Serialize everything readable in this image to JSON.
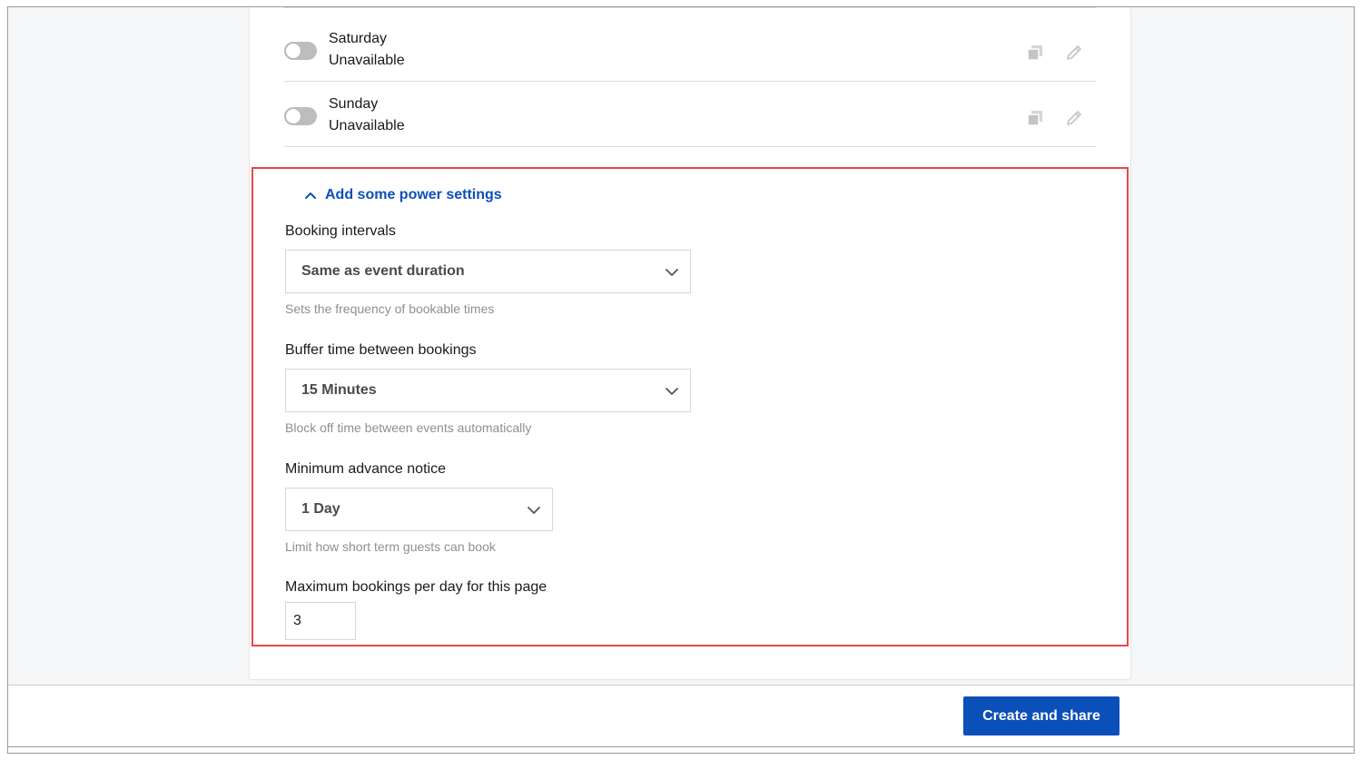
{
  "schedule": {
    "days": [
      {
        "name": "Saturday",
        "status": "Unavailable",
        "enabled": false
      },
      {
        "name": "Sunday",
        "status": "Unavailable",
        "enabled": false
      }
    ]
  },
  "power_settings": {
    "toggle_label": "Add some power settings",
    "expanded": true,
    "booking_intervals": {
      "label": "Booking intervals",
      "value": "Same as event duration",
      "help": "Sets the frequency of bookable times"
    },
    "buffer_time": {
      "label": "Buffer time between bookings",
      "value": "15 Minutes",
      "help": "Block off time between events automatically"
    },
    "advance_notice": {
      "label": "Minimum advance notice",
      "value": "1 Day",
      "help": "Limit how short term guests can book"
    },
    "max_bookings": {
      "label": "Maximum bookings per day for this page",
      "value": "3"
    }
  },
  "footer": {
    "cta_label": "Create and share"
  },
  "colors": {
    "accent": "#0b4fb9",
    "highlight": "#e5474c",
    "toggle_off": "#bdbdbd"
  },
  "icons": [
    "copy-icon",
    "pencil-icon",
    "chevron-up-icon",
    "chevron-down-icon"
  ]
}
